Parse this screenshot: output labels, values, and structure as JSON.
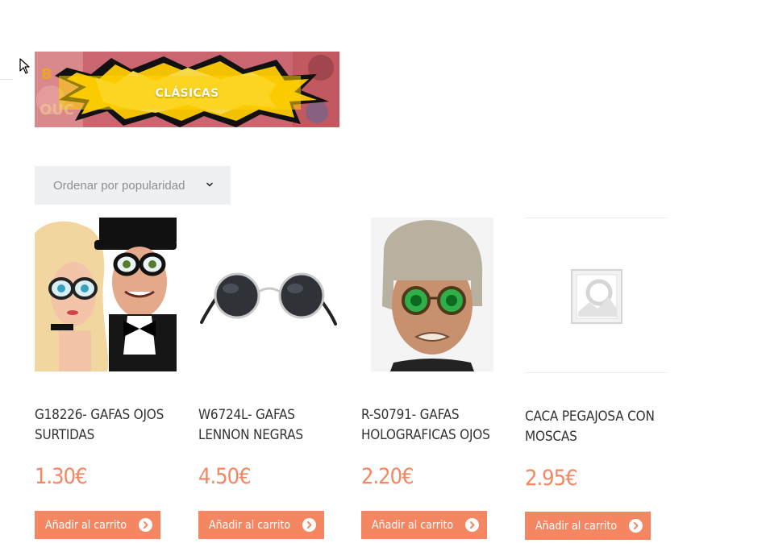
{
  "category": {
    "title": "CLÁSICAS"
  },
  "sort": {
    "selected": "Ordenar por popularidad"
  },
  "products": [
    {
      "title_line1": "G18226- GAFAS OJOS",
      "title_line2": "SURTIDAS",
      "price": "1.30€",
      "cart_label": "Añadir al carrito",
      "image": "party-glasses-couple-photo"
    },
    {
      "title_line1": "W6724L- GAFAS",
      "title_line2": "LENNON NEGRAS",
      "price": "4.50€",
      "cart_label": "Añadir al carrito",
      "image": "round-sunglasses-photo"
    },
    {
      "title_line1": "R-S0791- GAFAS",
      "title_line2": "HOLOGRAFICAS OJOS",
      "price": "2.20€",
      "cart_label": "Añadir al carrito",
      "image": "hologram-glasses-man-photo"
    },
    {
      "title_line1": "CACA PEGAJOSA CON",
      "title_line2": "MOSCAS",
      "price": "2.95€",
      "cart_label": "Añadir al carrito",
      "image": "placeholder-image"
    }
  ],
  "colors": {
    "accent": "#f58662",
    "sort_bg": "#eef0f2",
    "title_text": "#333333"
  }
}
